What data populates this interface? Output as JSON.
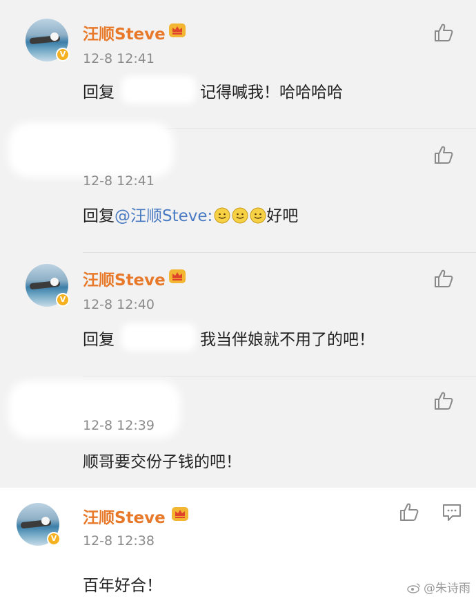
{
  "comments": [
    {
      "username": "汪顺Steve",
      "time": "12-8 12:41",
      "reply_prefix": "回复",
      "reply_body": "记得喊我！哈哈哈哈"
    },
    {
      "time": "12-8 12:41",
      "reply_prefix": "回复",
      "mention": "@汪顺Steve:",
      "reply_body": "好吧"
    },
    {
      "username": "汪顺Steve",
      "time": "12-8 12:40",
      "reply_prefix": "回复",
      "reply_body": "我当伴娘就不用了的吧！"
    },
    {
      "time": "12-8 12:39",
      "reply_body": "顺哥要交份子钱的吧！"
    },
    {
      "username": "汪顺Steve",
      "time": "12-8 12:38",
      "reply_body": "百年好合！"
    }
  ],
  "watermark": "@朱诗雨",
  "icons": {
    "like": "thumbs-up-icon",
    "reply": "comment-icon",
    "crown": "crown-badge-icon",
    "verified": "verified-v-icon"
  },
  "colors": {
    "username": "#e8792a",
    "mention": "#4a7bc2",
    "verified": "#f5b120"
  }
}
